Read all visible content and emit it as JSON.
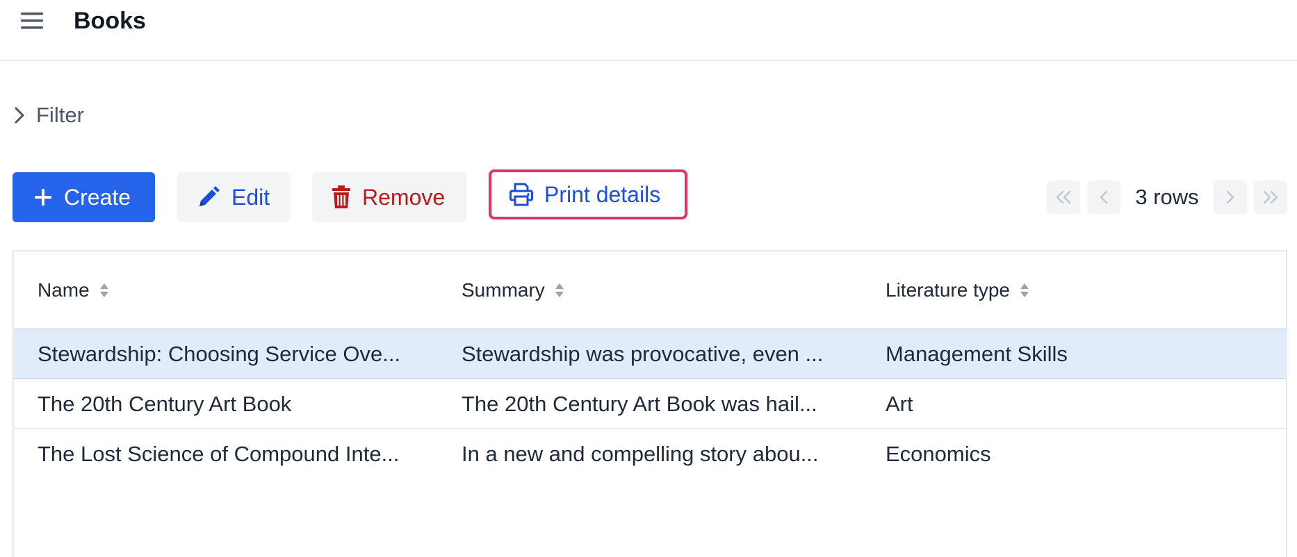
{
  "header": {
    "title": "Books",
    "menu_icon": "hamburger-menu-icon"
  },
  "filter": {
    "label": "Filter",
    "icon": "chevron-right-icon"
  },
  "toolbar": {
    "create_label": "Create",
    "edit_label": "Edit",
    "remove_label": "Remove",
    "print_label": "Print details",
    "colors": {
      "primary": "#2563eb",
      "danger": "#b91c1c",
      "highlight_outline": "#e0336b"
    }
  },
  "pager": {
    "rows_label": "3 rows"
  },
  "table": {
    "columns": [
      {
        "label": "Name"
      },
      {
        "label": "Summary"
      },
      {
        "label": "Literature type"
      }
    ],
    "rows": [
      {
        "name": "Stewardship: Choosing Service Ove...",
        "summary": "Stewardship was provocative, even ...",
        "type": "Management Skills",
        "selected": true
      },
      {
        "name": "The 20th Century Art Book",
        "summary": "The 20th Century Art Book was hail...",
        "type": "Art",
        "selected": false
      },
      {
        "name": "The Lost Science of Compound Inte...",
        "summary": "In a new and compelling story abou...",
        "type": "Economics",
        "selected": false
      }
    ],
    "selected_row_color": "#e1ecfb"
  }
}
